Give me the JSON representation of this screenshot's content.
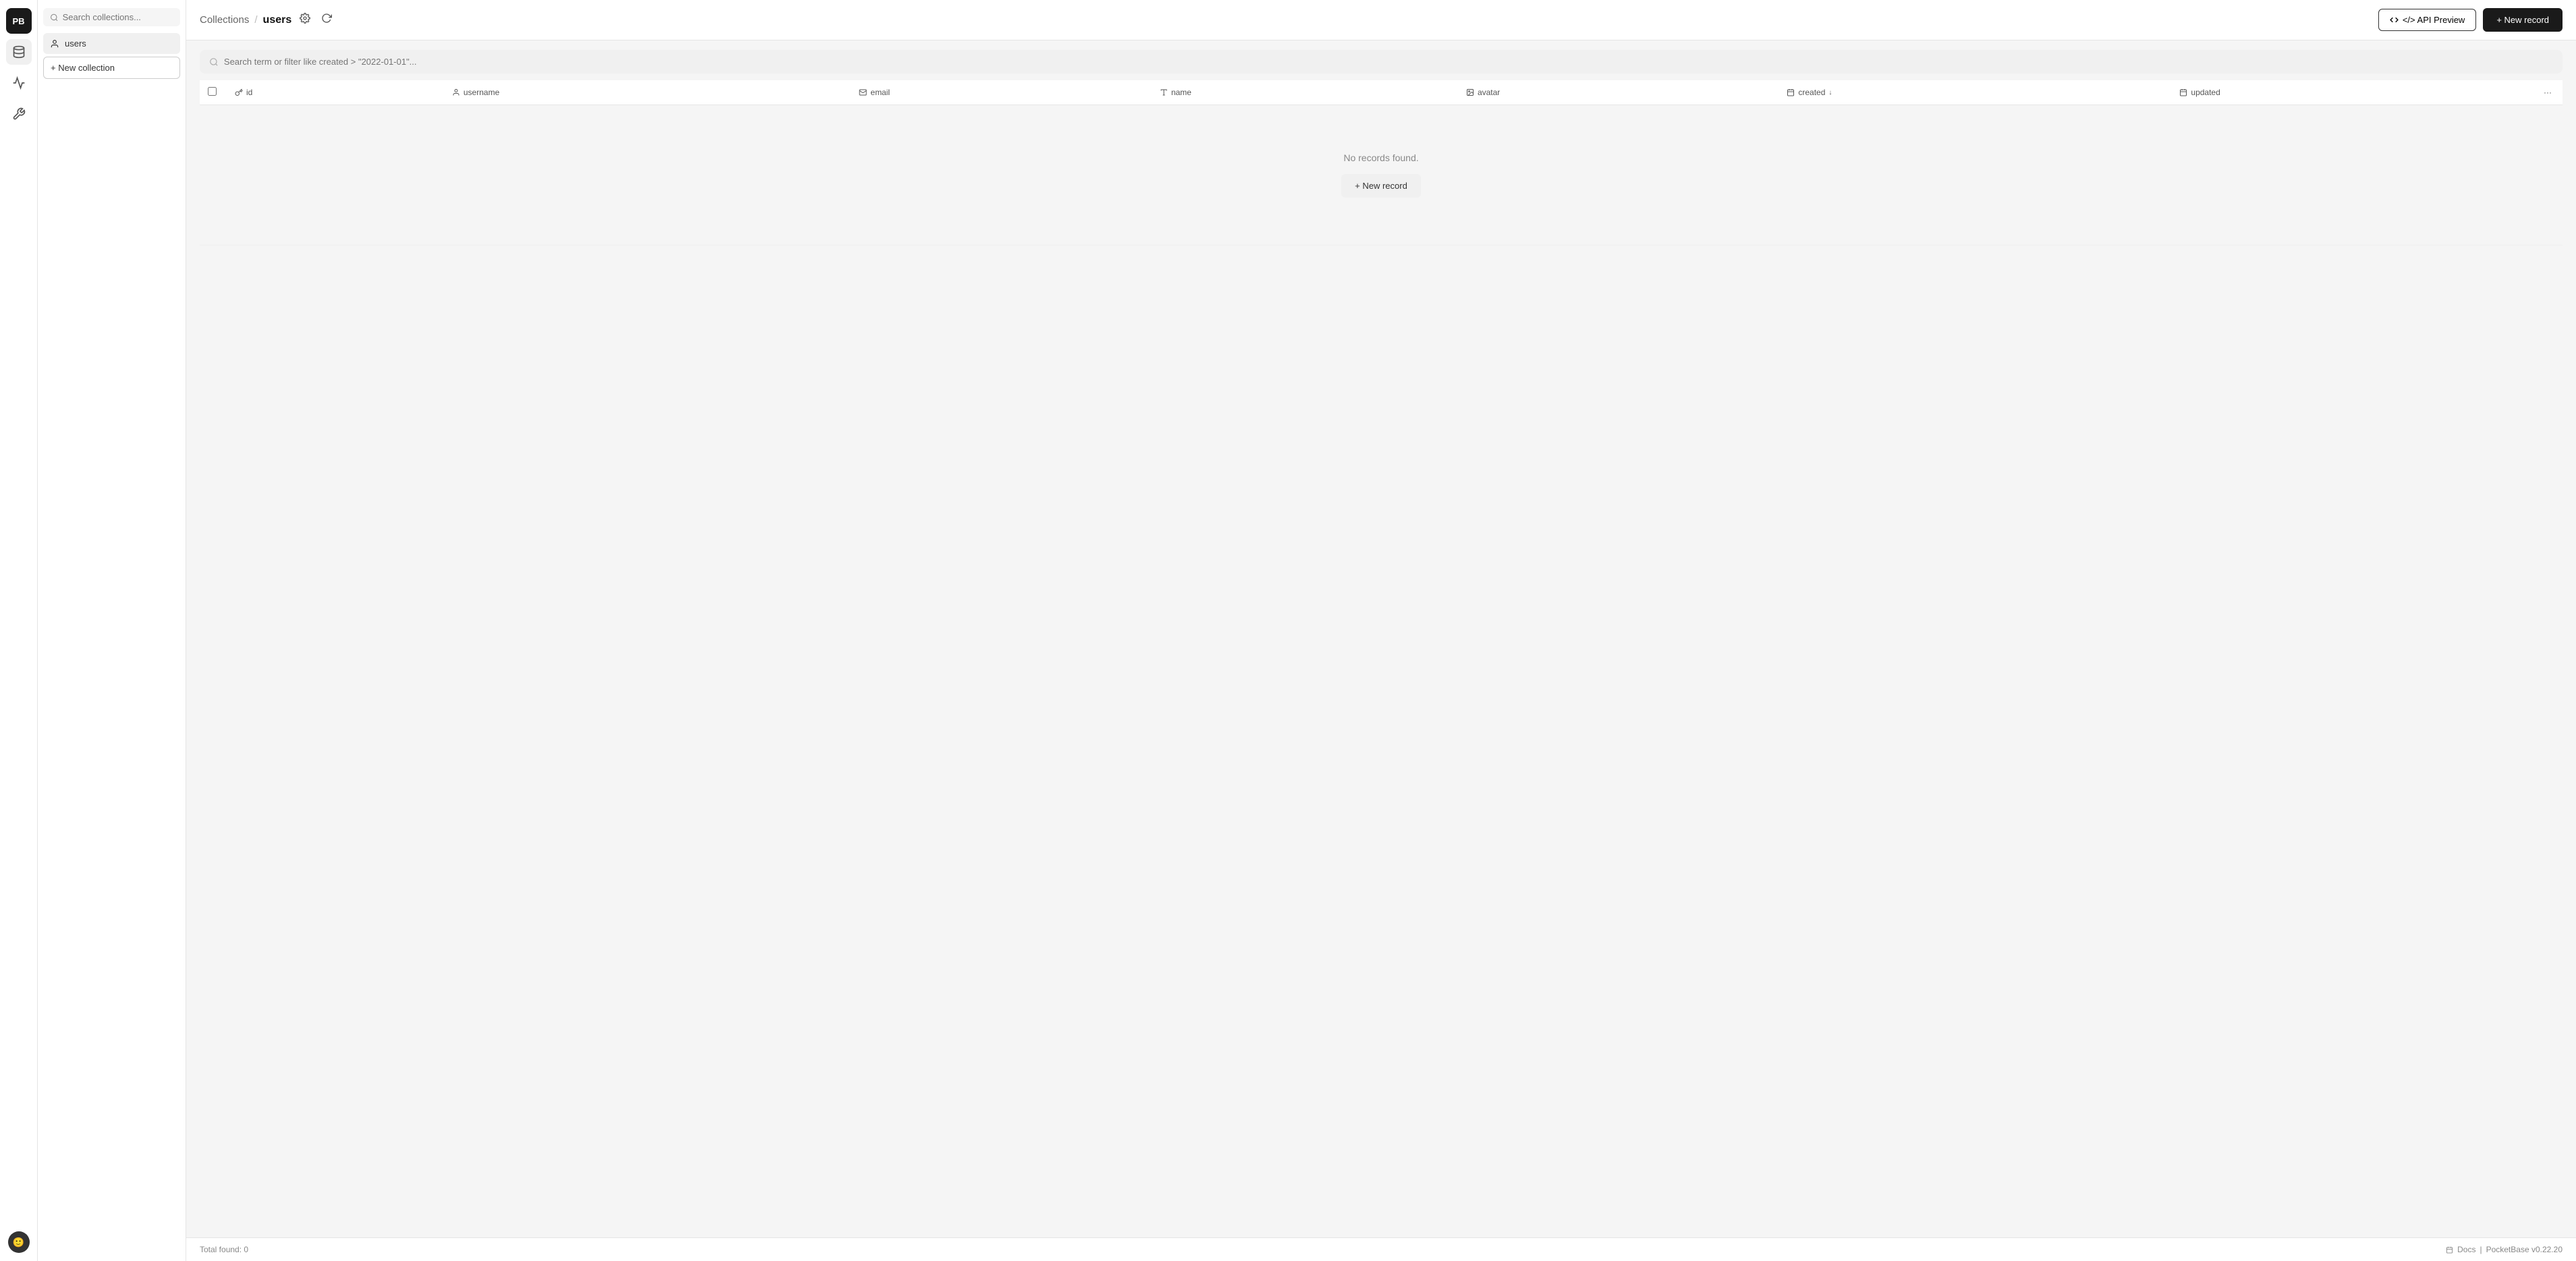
{
  "app": {
    "logo_text": "PB"
  },
  "sidebar": {
    "search_placeholder": "Search collections...",
    "items": [
      {
        "label": "users",
        "icon": "👤",
        "active": true
      }
    ],
    "new_collection_label": "+ New collection"
  },
  "header": {
    "breadcrumb_root": "Collections",
    "breadcrumb_sep": "/",
    "breadcrumb_current": "users",
    "api_preview_label": "</> API Preview",
    "new_record_label": "+ New record",
    "settings_icon": "⚙",
    "refresh_icon": "↻"
  },
  "table_search": {
    "placeholder": "Search term or filter like created > \"2022-01-01\"..."
  },
  "table": {
    "columns": [
      {
        "key": "id",
        "label": "id",
        "icon": "key"
      },
      {
        "key": "username",
        "label": "username",
        "icon": "user"
      },
      {
        "key": "email",
        "label": "email",
        "icon": "email"
      },
      {
        "key": "name",
        "label": "name",
        "icon": "text"
      },
      {
        "key": "avatar",
        "label": "avatar",
        "icon": "image"
      },
      {
        "key": "created",
        "label": "created",
        "icon": "calendar",
        "sorted": true,
        "sort_dir": "desc"
      },
      {
        "key": "updated",
        "label": "updated",
        "icon": "calendar"
      }
    ],
    "rows": [],
    "empty_message": "No records found.",
    "empty_new_record_label": "+ New record"
  },
  "footer": {
    "total_label": "Total found:",
    "total_count": "0",
    "docs_label": "Docs",
    "version_label": "PocketBase v0.22.20",
    "separator": "|"
  }
}
